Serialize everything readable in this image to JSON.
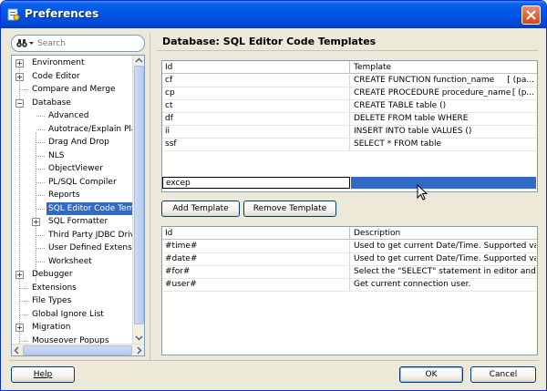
{
  "window": {
    "title": "Preferences"
  },
  "search": {
    "placeholder": "Search"
  },
  "tree": {
    "items": [
      {
        "label": "Environment",
        "expander": "+"
      },
      {
        "label": "Code Editor",
        "expander": "+"
      },
      {
        "label": "Compare and Merge",
        "expander": ""
      },
      {
        "label": "Database",
        "expander": "−"
      },
      {
        "label": "Advanced",
        "expander": ""
      },
      {
        "label": "Autotrace/Explain Plan",
        "expander": ""
      },
      {
        "label": "Drag And Drop",
        "expander": ""
      },
      {
        "label": "NLS",
        "expander": ""
      },
      {
        "label": "ObjectViewer",
        "expander": ""
      },
      {
        "label": "PL/SQL Compiler",
        "expander": ""
      },
      {
        "label": "Reports",
        "expander": ""
      },
      {
        "label": "SQL Editor Code Templates",
        "expander": ""
      },
      {
        "label": "SQL Formatter",
        "expander": "+"
      },
      {
        "label": "Third Party JDBC Drivers",
        "expander": ""
      },
      {
        "label": "User Defined Extensions",
        "expander": ""
      },
      {
        "label": "Worksheet",
        "expander": ""
      },
      {
        "label": "Debugger",
        "expander": "+"
      },
      {
        "label": "Extensions",
        "expander": ""
      },
      {
        "label": "File Types",
        "expander": ""
      },
      {
        "label": "Global Ignore List",
        "expander": ""
      },
      {
        "label": "Migration",
        "expander": "+"
      },
      {
        "label": "Mouseover Popups",
        "expander": ""
      }
    ]
  },
  "main": {
    "title": "Database: SQL Editor Code Templates",
    "templates": {
      "columns": [
        "Id",
        "Template"
      ],
      "rows": [
        {
          "id": "cf",
          "template": "CREATE FUNCTION function_name",
          "suffix": "[ (pa..."
        },
        {
          "id": "cp",
          "template": "CREATE PROCEDURE procedure_name",
          "suffix": "[ (p..."
        },
        {
          "id": "ct",
          "template": "CREATE TABLE table ()",
          "suffix": ""
        },
        {
          "id": "df",
          "template": "DELETE FROM table WHERE",
          "suffix": ""
        },
        {
          "id": "ii",
          "template": "INSERT INTO table VALUES ()",
          "suffix": ""
        },
        {
          "id": "ssf",
          "template": "SELECT * FROM table",
          "suffix": ""
        }
      ],
      "editing_row": {
        "id": "excep",
        "template": ""
      }
    },
    "add_template_label": "Add Template",
    "remove_template_label": "Remove Template",
    "variables": {
      "columns": [
        "Id",
        "Description"
      ],
      "rows": [
        {
          "id": "#time#",
          "description": "Used to get current Date/Time. Supported vari..."
        },
        {
          "id": "#date#",
          "description": "Used to get current Date/Time. Supported vari..."
        },
        {
          "id": "#for#",
          "description": "Select the \"SELECT\" statement in editor and in..."
        },
        {
          "id": "#user#",
          "description": "Get current connection user."
        }
      ]
    }
  },
  "footer": {
    "help_label": "Help",
    "ok_label": "OK",
    "cancel_label": "Cancel"
  },
  "colors": {
    "titlebar": "#0055e5",
    "selection": "#316ac5",
    "dialog_bg": "#ece9d8"
  }
}
